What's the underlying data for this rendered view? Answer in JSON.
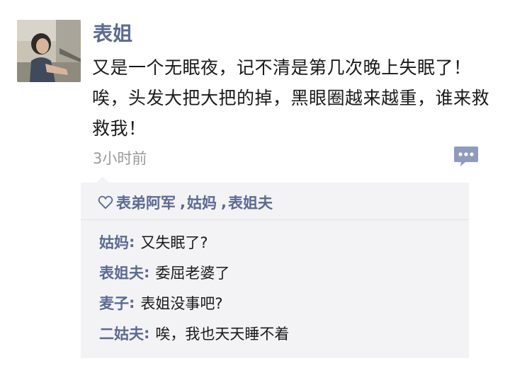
{
  "post": {
    "author": "表姐",
    "content": "又是一个无眠夜，记不清是第几次晚上失眠了！唉，头发大把大把的掉，黑眼圈越来越重，谁来救救我！",
    "time": "3小时前"
  },
  "likes": {
    "names": [
      "表弟阿军",
      "姑妈",
      "表姐夫"
    ],
    "separator": ","
  },
  "comments": [
    {
      "name": "姑妈",
      "text": "又失眠了?"
    },
    {
      "name": "表姐夫",
      "text": "委屈老婆了"
    },
    {
      "name": "麦子",
      "text": "表姐没事吧?"
    },
    {
      "name": "二姑夫",
      "text": "唉，我也天天睡不着"
    }
  ],
  "colors": {
    "name": "#5b6a92",
    "panel": "#f3f3f5",
    "text": "#1a1a1a",
    "time": "#9a9a9a"
  },
  "icons": {
    "comment": "speech-bubble-dots-icon",
    "like": "heart-outline-icon"
  }
}
